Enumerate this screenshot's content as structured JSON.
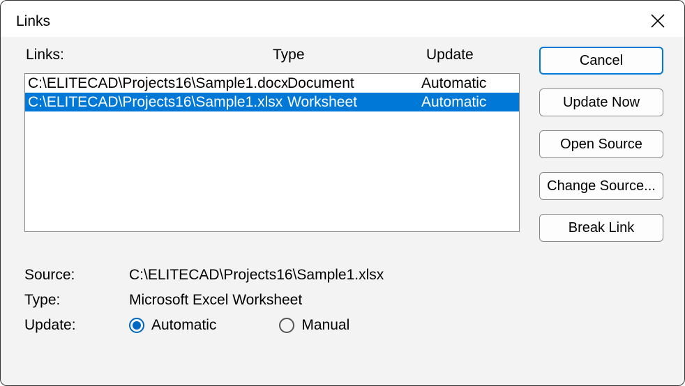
{
  "title": "Links",
  "headers": {
    "links": "Links:",
    "type": "Type",
    "update": "Update"
  },
  "rows": [
    {
      "path": "C:\\ELITECAD\\Projects16\\Sample1.docx",
      "type": "Document",
      "update": "Automatic",
      "selected": false
    },
    {
      "path": "C:\\ELITECAD\\Projects16\\Sample1.xlsx",
      "type": "Worksheet",
      "update": "Automatic",
      "selected": true
    }
  ],
  "buttons": {
    "cancel": "Cancel",
    "update_now": "Update Now",
    "open_source": "Open Source",
    "change_source": "Change Source...",
    "break_link": "Break Link"
  },
  "details": {
    "source_label": "Source:",
    "source_value": "C:\\ELITECAD\\Projects16\\Sample1.xlsx",
    "type_label": "Type:",
    "type_value": "Microsoft Excel Worksheet",
    "update_label": "Update:"
  },
  "radio": {
    "automatic": "Automatic",
    "manual": "Manual",
    "selected": "automatic"
  }
}
